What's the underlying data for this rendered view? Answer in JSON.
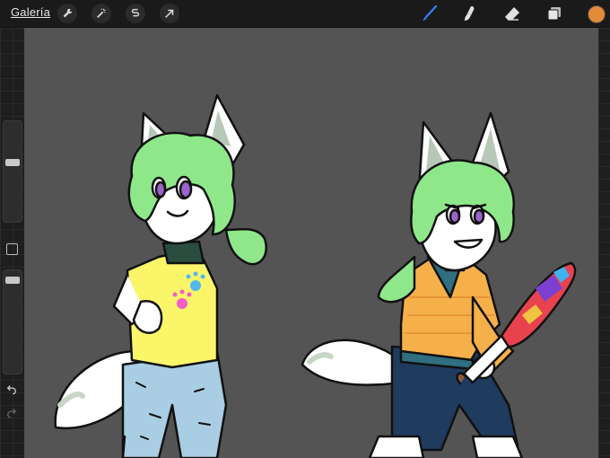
{
  "toolbar": {
    "gallery_label": "Galería",
    "left_tools": [
      {
        "icon": "wrench-icon"
      },
      {
        "icon": "magic-wand-icon"
      },
      {
        "icon": "selection-icon"
      },
      {
        "icon": "transform-arrow-icon"
      }
    ],
    "right_tools": [
      {
        "icon": "brush-icon"
      },
      {
        "icon": "smudge-icon"
      },
      {
        "icon": "eraser-icon"
      },
      {
        "icon": "layers-icon"
      }
    ],
    "current_color": "#e48b3a"
  },
  "sidebar": {
    "brush_size_level": 0.6,
    "opacity_level": 0.95
  },
  "colors": {
    "accent_blue": "#2f7cf6",
    "canvas_bg": "#545454",
    "hair_green": "#8ee88a",
    "fur_white": "#ffffff",
    "shirt_yellow": "#fbf56a",
    "jeans_blue": "#a9cde3",
    "hoodie_orange": "#f6b04a",
    "pants_navy": "#1f3b5e",
    "eye_purple": "#9b63c9"
  }
}
